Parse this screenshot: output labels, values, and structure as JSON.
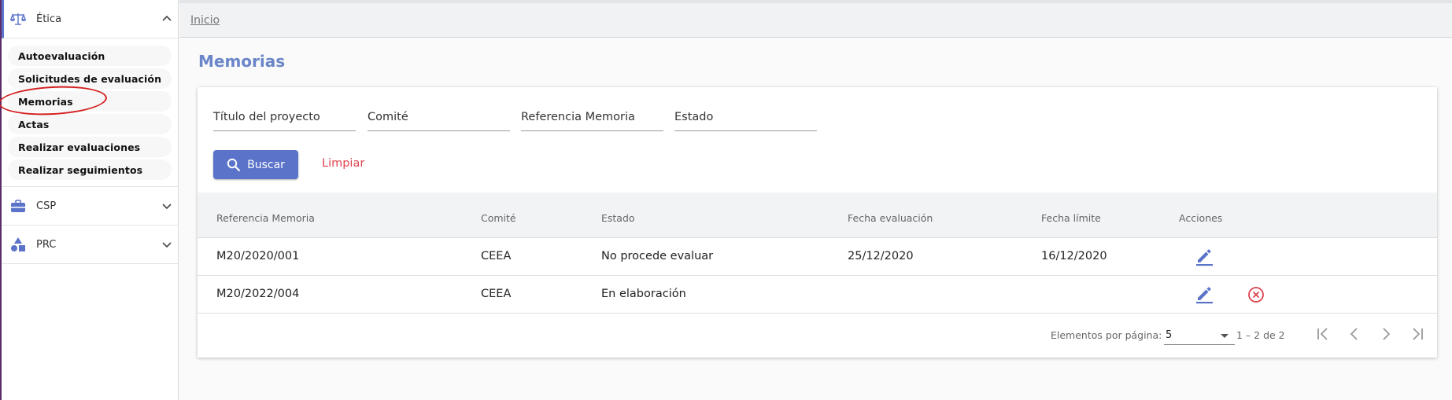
{
  "sidebar": {
    "groups": [
      {
        "label": "Ética",
        "icon": "scales-icon",
        "expanded": true,
        "items": [
          "Autoevaluación",
          "Solicitudes de evaluación",
          "Memorias",
          "Actas",
          "Realizar evaluaciones",
          "Realizar seguimientos"
        ],
        "current": "Memorias"
      },
      {
        "label": "CSP",
        "icon": "briefcase-icon",
        "expanded": false
      },
      {
        "label": "PRC",
        "icon": "shapes-icon",
        "expanded": false
      }
    ]
  },
  "breadcrumb": {
    "home": "Inicio"
  },
  "page": {
    "title": "Memorias"
  },
  "filters": {
    "titulo": "Título del proyecto",
    "comite": "Comité",
    "referencia": "Referencia Memoria",
    "estado": "Estado"
  },
  "buttons": {
    "search": "Buscar",
    "clear": "Limpiar"
  },
  "table": {
    "columns": [
      "Referencia Memoria",
      "Comité",
      "Estado",
      "Fecha evaluación",
      "Fecha límite",
      "Acciones"
    ],
    "rows": [
      {
        "referencia": "M20/2020/001",
        "comite": "CEEA",
        "estado": "No procede evaluar",
        "fecha_evaluacion": "25/12/2020",
        "fecha_limite": "16/12/2020",
        "actions": [
          "edit-icon"
        ]
      },
      {
        "referencia": "M20/2022/004",
        "comite": "CEEA",
        "estado": "En elaboración",
        "fecha_evaluacion": "",
        "fecha_limite": "",
        "actions": [
          "edit-icon",
          "delete-icon"
        ]
      }
    ]
  },
  "paginator": {
    "label": "Elementos por página:",
    "page_size": "5",
    "range": "1 – 2 de 2"
  },
  "colors": {
    "accent": "#5b73c9",
    "title": "#6a86c9",
    "danger": "#e0424e",
    "annotation": "#d32020"
  }
}
